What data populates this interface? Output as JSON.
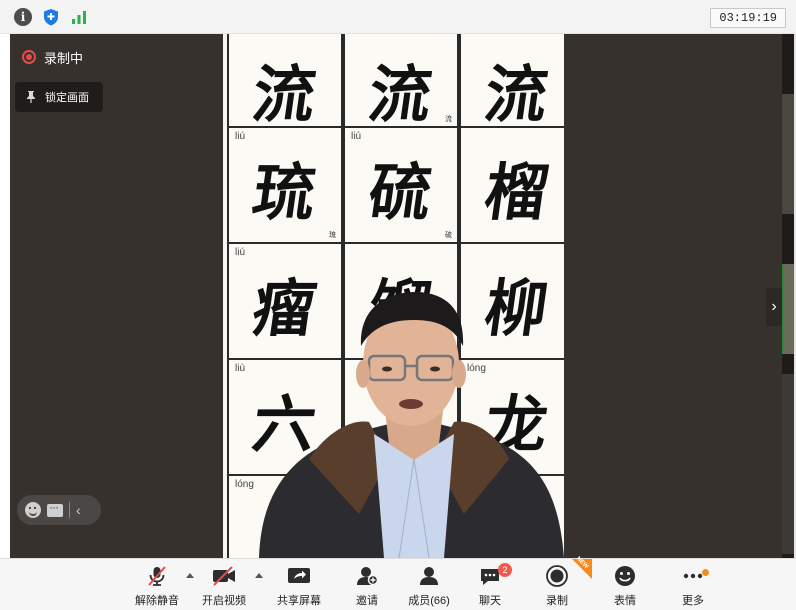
{
  "titlebar": {
    "timer": "03:19:19",
    "icons": [
      "info-icon",
      "shield-icon",
      "signal-icon"
    ]
  },
  "overlay": {
    "recording_label": "录制中",
    "lock_label": "锁定画面"
  },
  "video": {
    "cells": [
      {
        "pinyin": "",
        "char": "流",
        "small": ""
      },
      {
        "pinyin": "",
        "char": "流",
        "small": "流"
      },
      {
        "pinyin": "",
        "char": "流",
        "small": ""
      },
      {
        "pinyin": "liú",
        "char": "琉",
        "small": "琉"
      },
      {
        "pinyin": "liú",
        "char": "硫",
        "small": "硫"
      },
      {
        "pinyin": "",
        "char": "榴",
        "small": ""
      },
      {
        "pinyin": "liú",
        "char": "瘤",
        "small": ""
      },
      {
        "pinyin": "",
        "char": "馏",
        "small": "馏"
      },
      {
        "pinyin": "",
        "char": "柳",
        "small": ""
      },
      {
        "pinyin": "liù",
        "char": "六",
        "small": ""
      },
      {
        "pinyin": "",
        "char": "",
        "small": ""
      },
      {
        "pinyin": "lóng",
        "char": "龙",
        "small": ""
      },
      {
        "pinyin": "lóng",
        "char": "",
        "small": ""
      }
    ]
  },
  "toolbar": {
    "unmute": "解除静音",
    "start_video": "开启视频",
    "share_screen": "共享屏幕",
    "invite": "邀请",
    "participants": "成员(66)",
    "chat": "聊天",
    "chat_badge": "2",
    "record": "录制",
    "record_tag": "NEW",
    "reactions": "表情",
    "more": "更多"
  },
  "colors": {
    "stage_bg": "#36312c",
    "record_red": "#e84b4b",
    "badge_red": "#f05a4f",
    "accent_orange": "#f58a1f"
  }
}
